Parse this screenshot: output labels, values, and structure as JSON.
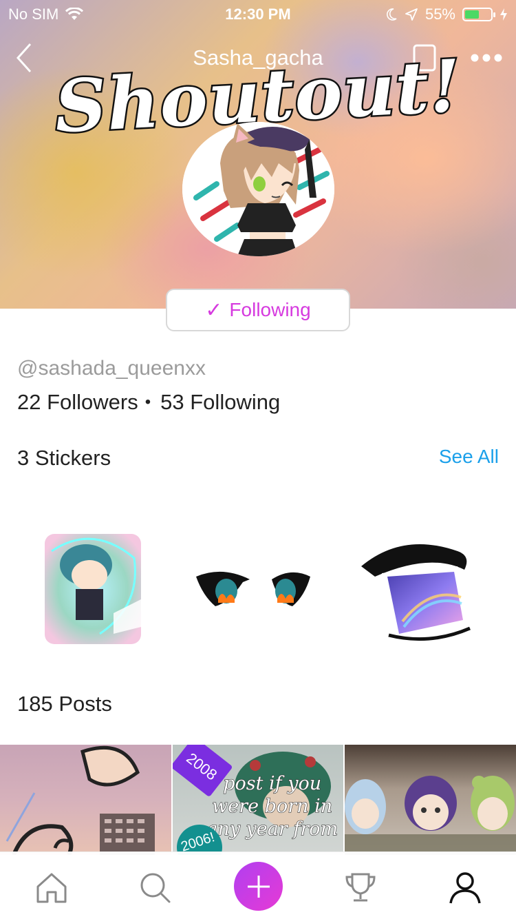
{
  "status_bar": {
    "carrier": "No SIM",
    "time": "12:30 PM",
    "battery": "55%",
    "battery_level": 0.55
  },
  "nav": {
    "title": "Sasha_gacha",
    "back_icon": "chevron-left-icon",
    "bookmark_icon": "bookmark-icon",
    "more_icon": "more-dots-icon"
  },
  "overlay_text": "Shoutout!",
  "follow_button": {
    "label": "Following"
  },
  "profile": {
    "handle": "@sashada_queenxx",
    "followers": "22 Followers",
    "following": "53 Following"
  },
  "stickers": {
    "title": "3 Stickers",
    "see_all": "See All"
  },
  "posts": {
    "title": "185 Posts",
    "items": [
      {},
      {
        "caption": "post if you were born in any year from",
        "tag1": "2008",
        "tag2": "2006!"
      },
      {}
    ]
  },
  "tabbar": {
    "items": [
      "home-icon",
      "search-icon",
      "add-icon",
      "trophy-icon",
      "profile-icon"
    ]
  },
  "colors": {
    "accent": "#d63adf",
    "link": "#1ba0ea"
  }
}
